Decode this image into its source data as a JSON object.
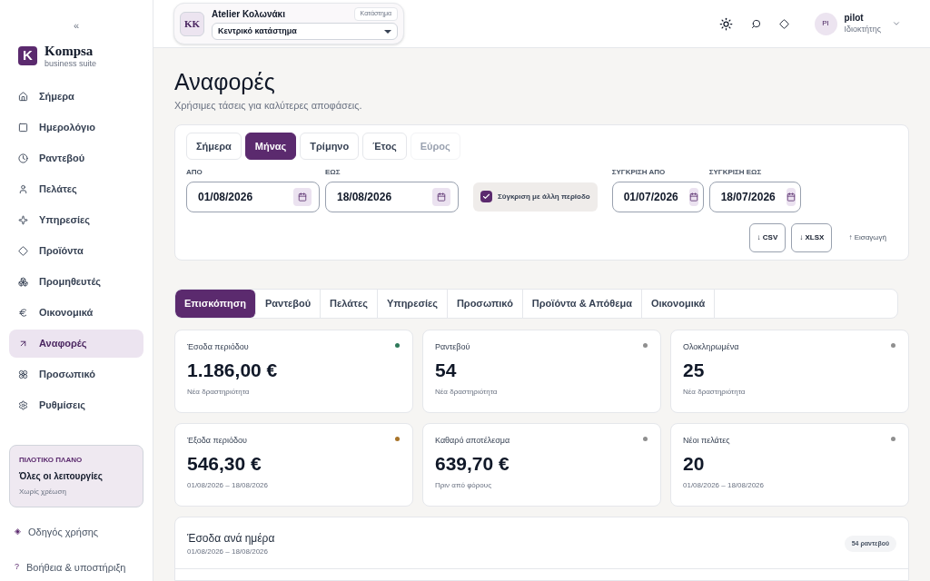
{
  "sidebar": {
    "collapse": "«",
    "logo": {
      "letter": "K",
      "name": "Kompsa",
      "tagline": "business suite"
    },
    "items": [
      {
        "label": "Σήμερα",
        "selected": false
      },
      {
        "label": "Ημερολόγιο",
        "selected": false
      },
      {
        "label": "Ραντεβού",
        "selected": false
      },
      {
        "label": "Πελάτες",
        "selected": false
      },
      {
        "label": "Υπηρεσίες",
        "selected": false
      },
      {
        "label": "Προϊόντα",
        "selected": false
      },
      {
        "label": "Προμηθευτές",
        "selected": false
      },
      {
        "label": "Οικονομικά",
        "selected": false
      },
      {
        "label": "Αναφορές",
        "selected": true
      },
      {
        "label": "Προσωπικό",
        "selected": false
      },
      {
        "label": "Ρυθμίσεις",
        "selected": false
      }
    ],
    "plan": {
      "eyebrow": "ΠΙΛΟΤΙΚΟ ΠΛΑΝΟ",
      "title": "Όλες οι λειτουργίες",
      "note": "Χωρίς χρέωση"
    },
    "footer_links": [
      {
        "icon": "◈",
        "label": "Οδηγός χρήσης"
      },
      {
        "icon": "?",
        "label": "Βοήθεια & υποστήριξη"
      }
    ]
  },
  "header": {
    "store": {
      "initials": "KK",
      "name": "Atelier Κολωνάκι",
      "badge": "Κατάστημα",
      "branch": "Κεντρικό κατάστημα"
    },
    "user": {
      "initials": "PI",
      "name": "pilot",
      "role": "Ιδιοκτήτης"
    }
  },
  "page": {
    "title": "Αναφορές",
    "subtitle": "Χρήσιμες τάσεις για καλύτερες αποφάσεις."
  },
  "filters": {
    "periods": [
      {
        "label": "Σήμερα",
        "selected": false,
        "disabled": false
      },
      {
        "label": "Μήνας",
        "selected": true,
        "disabled": false
      },
      {
        "label": "Τρίμηνο",
        "selected": false,
        "disabled": false
      },
      {
        "label": "Έτος",
        "selected": false,
        "disabled": false
      },
      {
        "label": "Εύρος",
        "selected": false,
        "disabled": true
      }
    ],
    "from": {
      "label": "ΑΠΟ",
      "value": "01/08/2026"
    },
    "to": {
      "label": "ΕΩΣ",
      "value": "18/08/2026"
    },
    "compare": {
      "label": "Σύγκριση με άλλη περίοδο",
      "checked": true
    },
    "compare_from": {
      "label": "ΣΥΓΚΡΙΣΗ ΑΠΟ",
      "value": "01/07/2026"
    },
    "compare_to": {
      "label": "ΣΥΓΚΡΙΣΗ ΕΩΣ",
      "value": "18/07/2026"
    },
    "exports": [
      "↓ CSV",
      "↓ XLSX"
    ],
    "import": "↑ Εισαγωγή"
  },
  "report_tabs": [
    {
      "label": "Επισκόπηση",
      "selected": true
    },
    {
      "label": "Ραντεβού",
      "selected": false
    },
    {
      "label": "Πελάτες",
      "selected": false
    },
    {
      "label": "Υπηρεσίες",
      "selected": false
    },
    {
      "label": "Προσωπικό",
      "selected": false
    },
    {
      "label": "Προϊόντα & Απόθεμα",
      "selected": false
    },
    {
      "label": "Οικονομικά",
      "selected": false
    }
  ],
  "stats": [
    {
      "label": "Έσοδα περιόδου",
      "value": "1.186,00 €",
      "note": "Νέα δραστηριότητα",
      "color": "#2f7a5a"
    },
    {
      "label": "Ραντεβού",
      "value": "54",
      "note": "Νέα δραστηριότητα",
      "color": "#8f8f8f"
    },
    {
      "label": "Ολοκληρωμένα",
      "value": "25",
      "note": "Νέα δραστηριότητα",
      "color": "#8f8f8f"
    },
    {
      "label": "Έξοδα περιόδου",
      "value": "546,30 €",
      "note": "01/08/2026 – 18/08/2026",
      "color": "#a8742a"
    },
    {
      "label": "Καθαρό αποτέλεσμα",
      "value": "639,70 €",
      "note": "Πριν από φόρους",
      "color": "#8f8f8f"
    },
    {
      "label": "Νέοι πελάτες",
      "value": "20",
      "note": "01/08/2026 – 18/08/2026",
      "color": "#8f8f8f"
    }
  ],
  "daily_revenue": {
    "title": "Έσοδα ανά ημέρα",
    "range": "01/08/2026 – 18/08/2026",
    "badge": "54 ραντεβού"
  }
}
